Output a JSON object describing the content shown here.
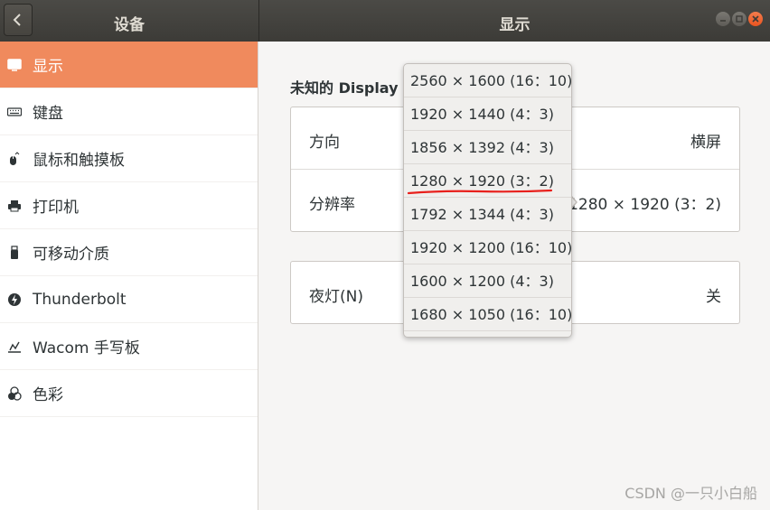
{
  "header": {
    "left_title": "设备",
    "right_title": "显示"
  },
  "sidebar": {
    "items": [
      {
        "label": "显示",
        "icon": "display-icon",
        "selected": true
      },
      {
        "label": "键盘",
        "icon": "keyboard-icon"
      },
      {
        "label": "鼠标和触摸板",
        "icon": "mouse-icon"
      },
      {
        "label": "打印机",
        "icon": "printer-icon"
      },
      {
        "label": "可移动介质",
        "icon": "usb-icon"
      },
      {
        "label": "Thunderbolt",
        "icon": "thunderbolt-icon"
      },
      {
        "label": "Wacom 手写板",
        "icon": "tablet-icon"
      },
      {
        "label": "色彩",
        "icon": "color-icon"
      }
    ]
  },
  "main": {
    "display_name": "未知的 Display",
    "orientation_label": "方向",
    "orientation_value": "横屏",
    "resolution_label": "分辨率",
    "resolution_value": "1280 × 1920 (3：2)",
    "night_light_label": "夜灯(N)",
    "night_light_value": "关"
  },
  "dropdown": {
    "options": [
      "2560 × 1600 (16：10)",
      "1920 × 1440 (4：3)",
      "1856 × 1392 (4：3)",
      "1280 × 1920 (3：2)",
      "1792 × 1344 (4：3)",
      "1920 × 1200 (16：10)",
      "1600 × 1200 (4：3)",
      "1680 × 1050 (16：10)"
    ]
  },
  "colors": {
    "accent": "#f08a5d",
    "header": "#3c3b37",
    "annotation": "#e8201c"
  },
  "watermark": "CSDN @一只小白船"
}
